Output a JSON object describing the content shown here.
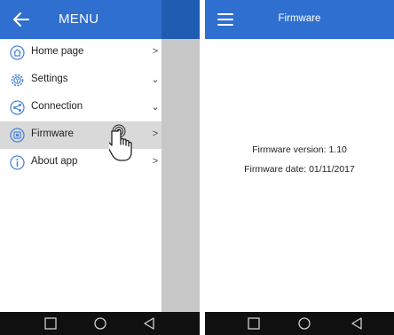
{
  "left": {
    "drawer_title": "MENU",
    "menu_items": [
      {
        "label": "Home page",
        "icon": "home-icon",
        "chevron": ">"
      },
      {
        "label": "Settings",
        "icon": "settings-icon",
        "chevron": "⌄"
      },
      {
        "label": "Connection",
        "icon": "connection-icon",
        "chevron": "⌄"
      },
      {
        "label": "Firmware",
        "icon": "firmware-icon",
        "chevron": ">",
        "active": true
      },
      {
        "label": "About app",
        "icon": "info-icon",
        "chevron": ">"
      }
    ]
  },
  "right": {
    "title": "Firmware",
    "firmware_version": "Firmware version: 1.10",
    "firmware_date": "Firmware date: 01/11/2017"
  },
  "colors": {
    "appbar": "#2f6fcf",
    "icon": "#4a86d9",
    "navbar": "#101010"
  },
  "navbar": {
    "buttons": [
      "recents-button",
      "home-button",
      "back-button"
    ]
  }
}
